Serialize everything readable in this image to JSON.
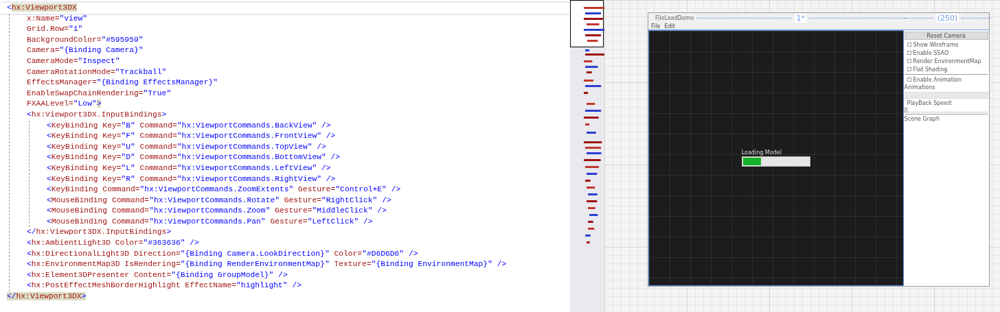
{
  "editor": {
    "lines": [
      {
        "segments": [
          {
            "kind": "p",
            "text": "<"
          },
          {
            "kind": "n",
            "text": "hx:Viewport3DX",
            "highlight": true
          }
        ],
        "current": true,
        "children": [
          {
            "segments": [
              {
                "kind": "n",
                "text": "x:Name="
              },
              {
                "kind": "v",
                "text": "\"view\""
              }
            ]
          },
          {
            "segments": [
              {
                "kind": "n",
                "text": "Grid.Row="
              },
              {
                "kind": "v",
                "text": "\"1\""
              }
            ]
          },
          {
            "segments": [
              {
                "kind": "n",
                "text": "BackgroundColor="
              },
              {
                "kind": "v",
                "text": "\"#595959\""
              }
            ]
          },
          {
            "segments": [
              {
                "kind": "n",
                "text": "Camera="
              },
              {
                "kind": "v",
                "text": "\"{Binding Camera}\""
              }
            ]
          },
          {
            "segments": [
              {
                "kind": "n",
                "text": "CameraMode="
              },
              {
                "kind": "v",
                "text": "\"Inspect\""
              }
            ]
          },
          {
            "segments": [
              {
                "kind": "n",
                "text": "CameraRotationMode="
              },
              {
                "kind": "v",
                "text": "\"Trackball\""
              }
            ]
          },
          {
            "segments": [
              {
                "kind": "n",
                "text": "EffectsManager="
              },
              {
                "kind": "v",
                "text": "\"{Binding EffectsManager}\""
              }
            ]
          },
          {
            "segments": [
              {
                "kind": "n",
                "text": "EnableSwapChainRendering="
              },
              {
                "kind": "v",
                "text": "\"True\""
              }
            ]
          },
          {
            "segments": [
              {
                "kind": "n",
                "text": "FXAALevel="
              },
              {
                "kind": "v",
                "text": "\"Low\""
              },
              {
                "kind": "p",
                "text": ">",
                "highlight": true
              }
            ]
          },
          {
            "segments": [
              {
                "kind": "p",
                "text": "<"
              },
              {
                "kind": "n",
                "text": "hx:Viewport3DX.InputBindings"
              },
              {
                "kind": "p",
                "text": ">"
              }
            ],
            "children": [
              {
                "segments": [
                  {
                    "kind": "p",
                    "text": "<"
                  },
                  {
                    "kind": "n",
                    "text": "KeyBinding Key="
                  },
                  {
                    "kind": "v",
                    "text": "\"B\""
                  },
                  {
                    "kind": "n",
                    "text": " Command="
                  },
                  {
                    "kind": "v",
                    "text": "\"hx:ViewportCommands.BackView\""
                  },
                  {
                    "kind": "p",
                    "text": " />"
                  }
                ]
              },
              {
                "segments": [
                  {
                    "kind": "p",
                    "text": "<"
                  },
                  {
                    "kind": "n",
                    "text": "KeyBinding Key="
                  },
                  {
                    "kind": "v",
                    "text": "\"F\""
                  },
                  {
                    "kind": "n",
                    "text": " Command="
                  },
                  {
                    "kind": "v",
                    "text": "\"hx:ViewportCommands.FrontView\""
                  },
                  {
                    "kind": "p",
                    "text": " />"
                  }
                ]
              },
              {
                "segments": [
                  {
                    "kind": "p",
                    "text": "<"
                  },
                  {
                    "kind": "n",
                    "text": "KeyBinding Key="
                  },
                  {
                    "kind": "v",
                    "text": "\"U\""
                  },
                  {
                    "kind": "n",
                    "text": " Command="
                  },
                  {
                    "kind": "v",
                    "text": "\"hx:ViewportCommands.TopView\""
                  },
                  {
                    "kind": "p",
                    "text": " />"
                  }
                ]
              },
              {
                "segments": [
                  {
                    "kind": "p",
                    "text": "<"
                  },
                  {
                    "kind": "n",
                    "text": "KeyBinding Key="
                  },
                  {
                    "kind": "v",
                    "text": "\"D\""
                  },
                  {
                    "kind": "n",
                    "text": " Command="
                  },
                  {
                    "kind": "v",
                    "text": "\"hx:ViewportCommands.BottomView\""
                  },
                  {
                    "kind": "p",
                    "text": " />"
                  }
                ]
              },
              {
                "segments": [
                  {
                    "kind": "p",
                    "text": "<"
                  },
                  {
                    "kind": "n",
                    "text": "KeyBinding Key="
                  },
                  {
                    "kind": "v",
                    "text": "\"L\""
                  },
                  {
                    "kind": "n",
                    "text": " Command="
                  },
                  {
                    "kind": "v",
                    "text": "\"hx:ViewportCommands.LeftView\""
                  },
                  {
                    "kind": "p",
                    "text": " />"
                  }
                ]
              },
              {
                "segments": [
                  {
                    "kind": "p",
                    "text": "<"
                  },
                  {
                    "kind": "n",
                    "text": "KeyBinding Key="
                  },
                  {
                    "kind": "v",
                    "text": "\"R\""
                  },
                  {
                    "kind": "n",
                    "text": " Command="
                  },
                  {
                    "kind": "v",
                    "text": "\"hx:ViewportCommands.RightView\""
                  },
                  {
                    "kind": "p",
                    "text": " />"
                  }
                ]
              },
              {
                "segments": [
                  {
                    "kind": "p",
                    "text": "<"
                  },
                  {
                    "kind": "n",
                    "text": "KeyBinding Command="
                  },
                  {
                    "kind": "v",
                    "text": "\"hx:ViewportCommands.ZoomExtents\""
                  },
                  {
                    "kind": "n",
                    "text": " Gesture="
                  },
                  {
                    "kind": "v",
                    "text": "\"Control+E\""
                  },
                  {
                    "kind": "p",
                    "text": " />"
                  }
                ]
              },
              {
                "segments": [
                  {
                    "kind": "p",
                    "text": "<"
                  },
                  {
                    "kind": "n",
                    "text": "MouseBinding Command="
                  },
                  {
                    "kind": "v",
                    "text": "\"hx:ViewportCommands.Rotate\""
                  },
                  {
                    "kind": "n",
                    "text": " Gesture="
                  },
                  {
                    "kind": "v",
                    "text": "\"RightClick\""
                  },
                  {
                    "kind": "p",
                    "text": " />"
                  }
                ]
              },
              {
                "segments": [
                  {
                    "kind": "p",
                    "text": "<"
                  },
                  {
                    "kind": "n",
                    "text": "MouseBinding Command="
                  },
                  {
                    "kind": "v",
                    "text": "\"hx:ViewportCommands.Zoom\""
                  },
                  {
                    "kind": "n",
                    "text": " Gesture="
                  },
                  {
                    "kind": "v",
                    "text": "\"MiddleClick\""
                  },
                  {
                    "kind": "p",
                    "text": " />"
                  }
                ]
              },
              {
                "segments": [
                  {
                    "kind": "p",
                    "text": "<"
                  },
                  {
                    "kind": "n",
                    "text": "MouseBinding Command="
                  },
                  {
                    "kind": "v",
                    "text": "\"hx:ViewportCommands.Pan\""
                  },
                  {
                    "kind": "n",
                    "text": " Gesture="
                  },
                  {
                    "kind": "v",
                    "text": "\"LeftClick\""
                  },
                  {
                    "kind": "p",
                    "text": " />"
                  }
                ]
              }
            ]
          },
          {
            "segments": [
              {
                "kind": "p",
                "text": "</"
              },
              {
                "kind": "n",
                "text": "hx:Viewport3DX.InputBindings"
              },
              {
                "kind": "p",
                "text": ">"
              }
            ]
          },
          {
            "segments": [
              {
                "kind": "p",
                "text": "<"
              },
              {
                "kind": "n",
                "text": "hx:AmbientLight3D Color="
              },
              {
                "kind": "v",
                "text": "\"#363636\""
              },
              {
                "kind": "p",
                "text": " />"
              }
            ]
          },
          {
            "segments": [
              {
                "kind": "p",
                "text": "<"
              },
              {
                "kind": "n",
                "text": "hx:DirectionalLight3D Direction="
              },
              {
                "kind": "v",
                "text": "\"{Binding Camera.LookDirection}\""
              },
              {
                "kind": "n",
                "text": " Color="
              },
              {
                "kind": "v",
                "text": "\"#D6D6D6\""
              },
              {
                "kind": "p",
                "text": " />"
              }
            ]
          },
          {
            "segments": [
              {
                "kind": "p",
                "text": "<"
              },
              {
                "kind": "n",
                "text": "hx:EnvironmentMap3D IsRendering="
              },
              {
                "kind": "v",
                "text": "\"{Binding RenderEnvironmentMap}\""
              },
              {
                "kind": "n",
                "text": " Texture="
              },
              {
                "kind": "v",
                "text": "\"{Binding EnvironmentMap}\""
              },
              {
                "kind": "p",
                "text": " />"
              }
            ]
          },
          {
            "segments": [
              {
                "kind": "p",
                "text": "<"
              },
              {
                "kind": "n",
                "text": "hx:Element3DPresenter Content="
              },
              {
                "kind": "v",
                "text": "\"{Binding GroupModel}\""
              },
              {
                "kind": "p",
                "text": " />"
              }
            ]
          },
          {
            "segments": [
              {
                "kind": "p",
                "text": "<"
              },
              {
                "kind": "n",
                "text": "hx:PostEffectMeshBorderHighlight EffectName="
              },
              {
                "kind": "v",
                "text": "\"highlight\""
              },
              {
                "kind": "p",
                "text": " />"
              }
            ]
          }
        ]
      },
      {
        "segments": [
          {
            "kind": "p",
            "text": "</",
            "highlight": true
          },
          {
            "kind": "n",
            "text": "hx:Viewport3DX",
            "highlight": true
          },
          {
            "kind": "p",
            "text": ">",
            "highlight": true
          }
        ]
      }
    ]
  },
  "designer": {
    "window_title": "FileLoadDemo",
    "column_sizes": [
      "1*",
      "(250)"
    ],
    "menu": [
      "File",
      "Edit"
    ],
    "loading": {
      "label": "Loading Model",
      "level": 0.27
    },
    "panel": {
      "reset_button": "Reset Camera",
      "options": [
        {
          "label": "Show Wireframe",
          "checked": false
        },
        {
          "label": "Enable SSAO",
          "checked": false
        },
        {
          "label": "Render EnvironmentMap",
          "checked": false
        },
        {
          "label": "Flat Shading",
          "checked": false
        }
      ],
      "animation_toggle": {
        "label": "Enable Animation",
        "checked": false
      },
      "animations_label": "Animations",
      "speed_label": "PlayBack Speed:",
      "speed_slider": {
        "level": 0
      },
      "scene_graph_label": "Scene Graph"
    }
  }
}
